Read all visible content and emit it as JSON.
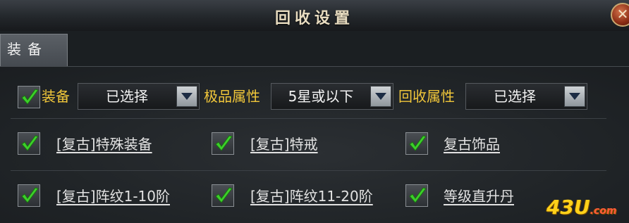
{
  "window": {
    "title": "回收设置",
    "close_label": "✕"
  },
  "tabs": [
    {
      "label": "装备",
      "active": true
    }
  ],
  "filter_row": {
    "checkbox_checked": true,
    "equip_label": "装备",
    "equip_value": "已选择",
    "quality_label": "极品属性",
    "quality_value": "5星或以下",
    "recycle_attr_label": "回收属性",
    "recycle_attr_value": "已选择"
  },
  "options": [
    {
      "label": "[复古]特殊装备",
      "checked": true
    },
    {
      "label": "[复古]特戒",
      "checked": true
    },
    {
      "label": "复古饰品",
      "checked": true
    },
    {
      "label": "[复古]阵纹1-10阶",
      "checked": true
    },
    {
      "label": "[复古]阵纹11-20阶",
      "checked": true
    },
    {
      "label": "等级直升丹",
      "checked": true
    }
  ],
  "watermark": {
    "text": "43U",
    "suffix": ".com"
  },
  "colors": {
    "accent_gold": "#f0c63a",
    "check_green": "#3ccf2a"
  }
}
